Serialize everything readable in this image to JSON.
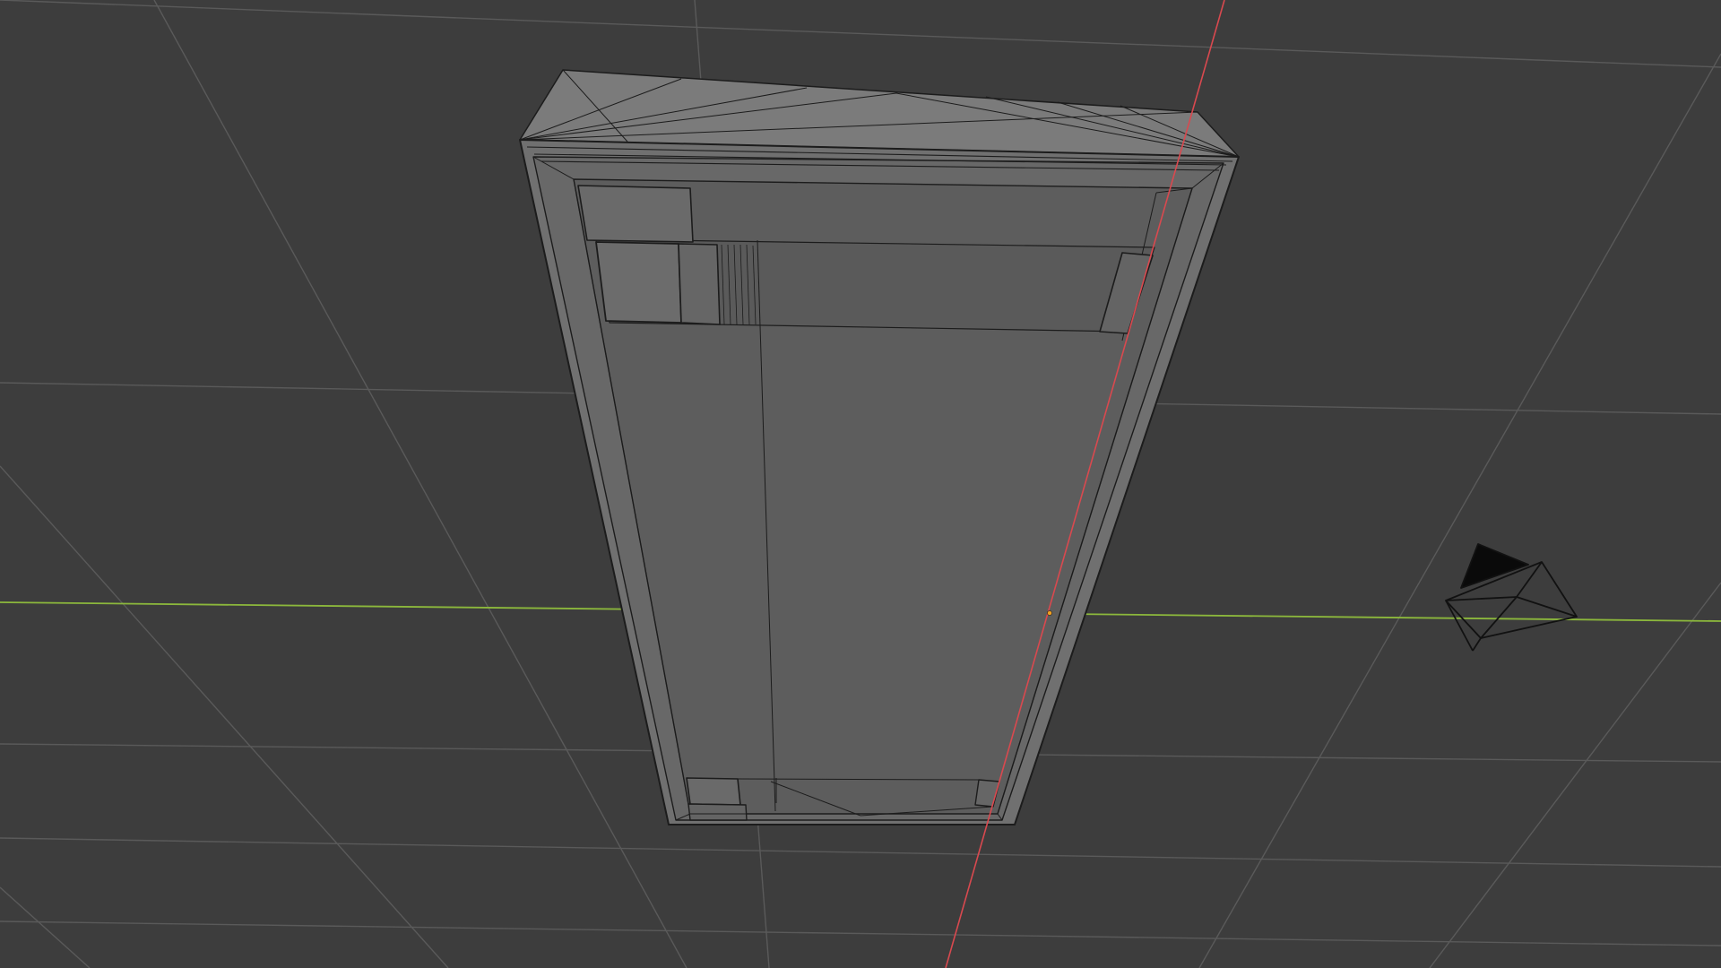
{
  "viewport": {
    "name": "3D Viewport",
    "background_color": "#3d3d3d",
    "grid_color": "#5a5a5a",
    "axis_x_color": "#d9494f",
    "axis_y_color": "#8cb83c",
    "mesh_face_color": "#6a6a6a",
    "mesh_edge_color": "#1c1c1c",
    "origin_color": "#f0a020",
    "shading": "solid-wireframe"
  },
  "objects": [
    {
      "name": "enclosure-box",
      "type": "mesh"
    },
    {
      "name": "camera",
      "type": "camera",
      "icon": "camera-object-icon"
    }
  ]
}
